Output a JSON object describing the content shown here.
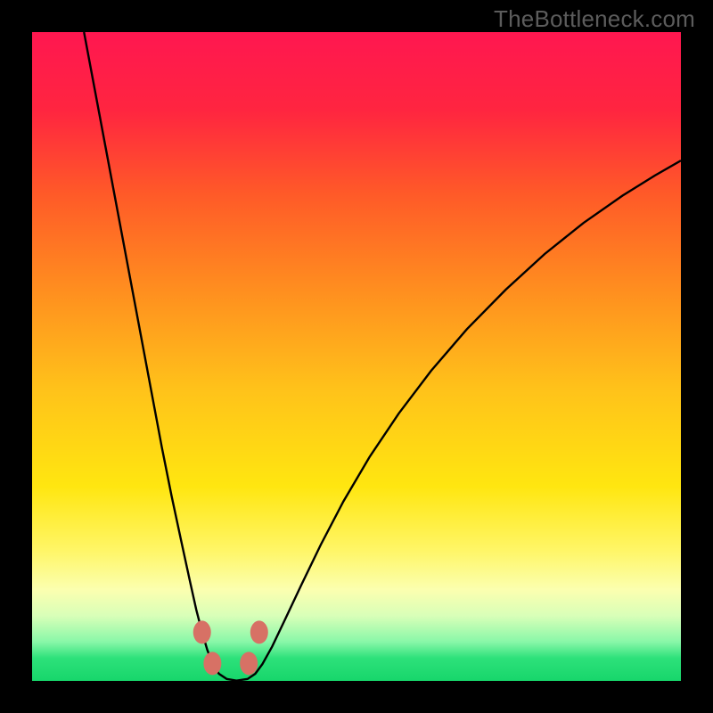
{
  "watermark": "TheBottleneck.com",
  "chart_data": {
    "type": "line",
    "title": "",
    "xlabel": "",
    "ylabel": "",
    "xlim": [
      0,
      100
    ],
    "ylim": [
      0,
      100
    ],
    "background_gradient_stops": [
      {
        "pos": 0.0,
        "color": "#ff1750"
      },
      {
        "pos": 0.12,
        "color": "#ff2540"
      },
      {
        "pos": 0.25,
        "color": "#ff5a28"
      },
      {
        "pos": 0.4,
        "color": "#ff8f1f"
      },
      {
        "pos": 0.55,
        "color": "#ffc21a"
      },
      {
        "pos": 0.7,
        "color": "#ffe610"
      },
      {
        "pos": 0.8,
        "color": "#fff668"
      },
      {
        "pos": 0.86,
        "color": "#fbffb0"
      },
      {
        "pos": 0.9,
        "color": "#d8ffb8"
      },
      {
        "pos": 0.94,
        "color": "#88f7a8"
      },
      {
        "pos": 0.965,
        "color": "#2de17a"
      },
      {
        "pos": 1.0,
        "color": "#17d66b"
      }
    ],
    "curve_points_xy_percent": [
      [
        8.0,
        100.0
      ],
      [
        9.5,
        92.0
      ],
      [
        11.0,
        84.0
      ],
      [
        12.5,
        76.0
      ],
      [
        14.0,
        68.0
      ],
      [
        15.5,
        60.0
      ],
      [
        17.0,
        52.0
      ],
      [
        18.5,
        44.0
      ],
      [
        20.0,
        36.0
      ],
      [
        21.5,
        28.5
      ],
      [
        23.0,
        21.5
      ],
      [
        24.3,
        15.5
      ],
      [
        25.3,
        11.0
      ],
      [
        26.2,
        7.5
      ],
      [
        27.0,
        4.8
      ],
      [
        27.8,
        2.7
      ],
      [
        28.8,
        1.1
      ],
      [
        30.0,
        0.3
      ],
      [
        31.5,
        0.05
      ],
      [
        33.2,
        0.3
      ],
      [
        34.4,
        1.1
      ],
      [
        35.5,
        2.6
      ],
      [
        37.0,
        5.3
      ],
      [
        39.0,
        9.5
      ],
      [
        41.5,
        14.8
      ],
      [
        44.5,
        21.0
      ],
      [
        48.0,
        27.7
      ],
      [
        52.0,
        34.5
      ],
      [
        56.5,
        41.2
      ],
      [
        61.5,
        47.8
      ],
      [
        67.0,
        54.2
      ],
      [
        73.0,
        60.3
      ],
      [
        79.0,
        65.8
      ],
      [
        85.0,
        70.6
      ],
      [
        91.0,
        74.8
      ],
      [
        96.0,
        77.9
      ],
      [
        100.0,
        80.2
      ]
    ],
    "markers_xy_percent": [
      [
        26.2,
        7.5
      ],
      [
        27.8,
        2.7
      ],
      [
        33.4,
        2.7
      ],
      [
        35.0,
        7.5
      ]
    ],
    "marker_color": "#d77165",
    "curve_color": "#000000"
  }
}
